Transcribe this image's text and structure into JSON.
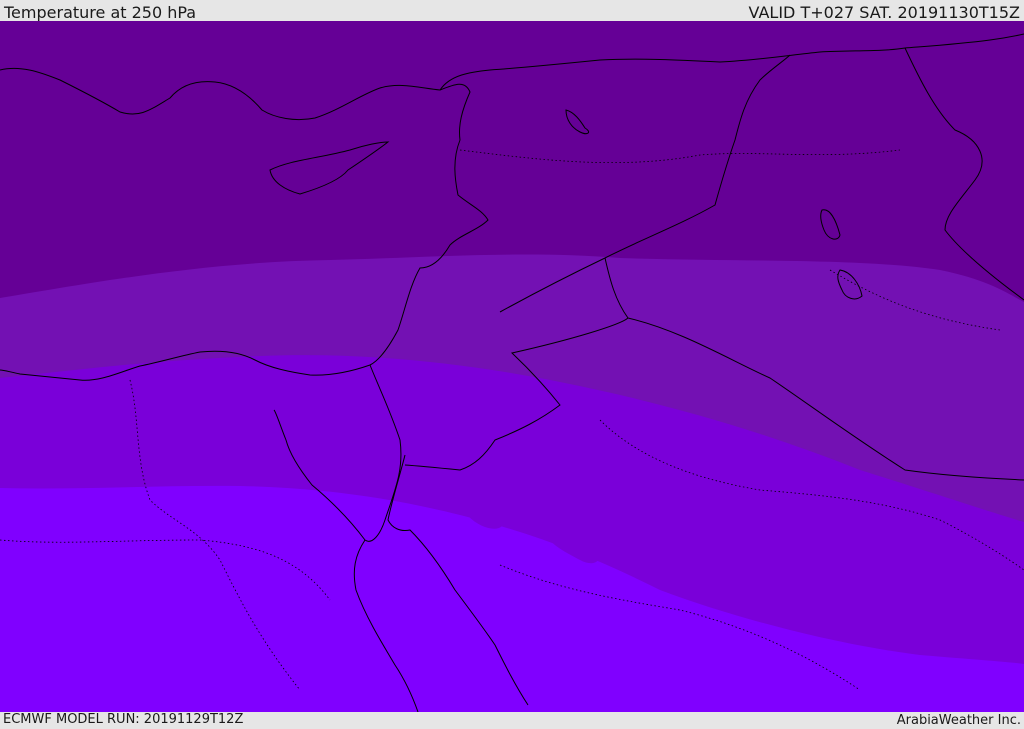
{
  "header": {
    "title": "Temperature at 250 hPa",
    "valid": "VALID T+027 SAT. 20191130T15Z"
  },
  "footer": {
    "model_run": "ECMWF MODEL RUN: 20191129T12Z",
    "credit": "ArabiaWeather Inc."
  },
  "colors": {
    "band_coldest": "#650096",
    "band_cold": "#7311b3",
    "band_mid": "#7a00d9",
    "band_warm": "#8000ff",
    "coastline": "#000000",
    "frame": "#e6e6e6"
  }
}
